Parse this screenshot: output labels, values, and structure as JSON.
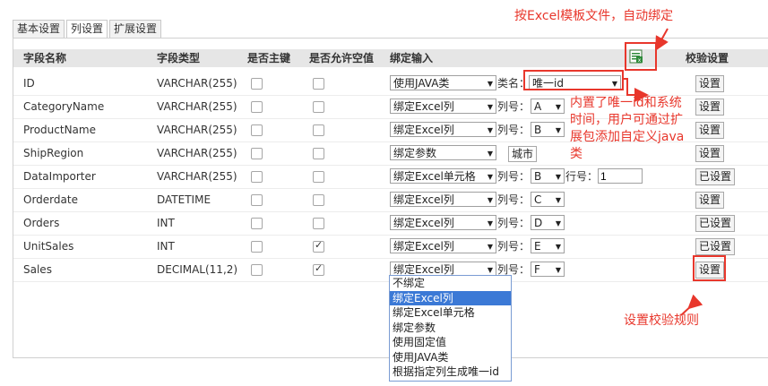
{
  "tabs": [
    "基本设置",
    "列设置",
    "扩展设置"
  ],
  "active_tab": 1,
  "headers": {
    "name": "字段名称",
    "type": "字段类型",
    "pk": "是否主键",
    "nullable": "是否允许空值",
    "bind": "绑定输入",
    "validate": "校验设置"
  },
  "excel_icon": "excel-template-icon",
  "rows": [
    {
      "name": "ID",
      "type": "VARCHAR(255)",
      "pk": false,
      "nullable": false,
      "bind": "使用JAVA类",
      "extra_label": "类名：",
      "extra_value": "唯一id",
      "btn": "设置"
    },
    {
      "name": "CategoryName",
      "type": "VARCHAR(255)",
      "pk": false,
      "nullable": false,
      "bind": "绑定Excel列",
      "extra_label": "列号：",
      "extra_value": "A",
      "btn": "设置"
    },
    {
      "name": "ProductName",
      "type": "VARCHAR(255)",
      "pk": false,
      "nullable": false,
      "bind": "绑定Excel列",
      "extra_label": "列号：",
      "extra_value": "B",
      "btn": "设置"
    },
    {
      "name": "ShipRegion",
      "type": "VARCHAR(255)",
      "pk": false,
      "nullable": false,
      "bind": "绑定参数",
      "extra_label": "",
      "extra_value": "城市",
      "btn": "设置"
    },
    {
      "name": "DataImporter",
      "type": "VARCHAR(255)",
      "pk": false,
      "nullable": false,
      "bind": "绑定Excel单元格",
      "extra_label": "列号：",
      "extra_value": "B",
      "extra2_label": "行号：",
      "extra2_value": "1",
      "btn": "已设置"
    },
    {
      "name": "Orderdate",
      "type": "DATETIME",
      "pk": false,
      "nullable": false,
      "bind": "绑定Excel列",
      "extra_label": "列号：",
      "extra_value": "C",
      "btn": "设置"
    },
    {
      "name": "Orders",
      "type": "INT",
      "pk": false,
      "nullable": false,
      "bind": "绑定Excel列",
      "extra_label": "列号：",
      "extra_value": "D",
      "btn": "已设置"
    },
    {
      "name": "UnitSales",
      "type": "INT",
      "pk": false,
      "nullable": true,
      "bind": "绑定Excel列",
      "extra_label": "列号：",
      "extra_value": "E",
      "btn": "已设置"
    },
    {
      "name": "Sales",
      "type": "DECIMAL(11,2)",
      "pk": false,
      "nullable": true,
      "bind": "绑定Excel列",
      "extra_label": "列号：",
      "extra_value": "F",
      "btn": "设置"
    }
  ],
  "dropdown_options": [
    "不绑定",
    "绑定Excel列",
    "绑定Excel单元格",
    "绑定参数",
    "使用固定值",
    "使用JAVA类",
    "根据指定列生成唯一id"
  ],
  "dropdown_selected": 1,
  "annotations": {
    "top": "按Excel模板文件，自动绑定",
    "middle_lines": [
      "内置了唯一id和系统",
      "时间，用户可通过扩",
      "展包添加自定义java",
      "类"
    ],
    "bottom": "设置校验规则"
  },
  "colors": {
    "accent_red": "#e8372c",
    "header_bg": "#e6e6e6",
    "highlight": "#3b79d6"
  }
}
